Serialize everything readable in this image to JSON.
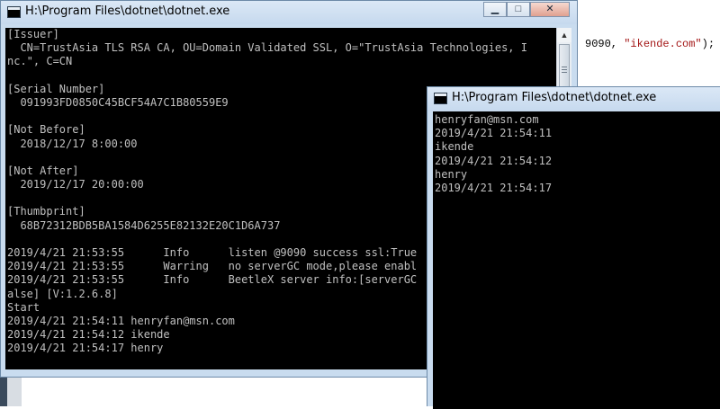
{
  "background": {
    "code_prefix": "9090, ",
    "code_string": "\"ikende.com\"",
    "code_suffix": ");"
  },
  "window_main": {
    "title": "H:\\Program Files\\dotnet\\dotnet.exe",
    "buttons": {
      "minimize": "▁",
      "maximize": "□",
      "close": "✕"
    },
    "scroll_up": "▲",
    "console_lines": [
      "[Issuer]",
      "  CN=TrustAsia TLS RSA CA, OU=Domain Validated SSL, O=\"TrustAsia Technologies, I",
      "nc.\", C=CN",
      "",
      "[Serial Number]",
      "  091993FD0850C45BCF54A7C1B80559E9",
      "",
      "[Not Before]",
      "  2018/12/17 8:00:00",
      "",
      "[Not After]",
      "  2019/12/17 20:00:00",
      "",
      "[Thumbprint]",
      "  68B72312BDB5BA1584D6255E82132E20C1D6A737",
      "",
      "2019/4/21 21:53:55      Info      listen @9090 success ssl:True",
      "2019/4/21 21:53:55      Warring   no serverGC mode,please enabl",
      "2019/4/21 21:53:55      Info      BeetleX server info:[serverGC",
      "alse] [V:1.2.6.8]",
      "Start",
      "2019/4/21 21:54:11 henryfan@msn.com",
      "2019/4/21 21:54:12 ikende",
      "2019/4/21 21:54:17 henry"
    ]
  },
  "window_second": {
    "title": "H:\\Program Files\\dotnet\\dotnet.exe",
    "console_lines": [
      "henryfan@msn.com",
      "2019/4/21 21:54:11",
      "ikende",
      "2019/4/21 21:54:12",
      "henry",
      "2019/4/21 21:54:17"
    ]
  }
}
